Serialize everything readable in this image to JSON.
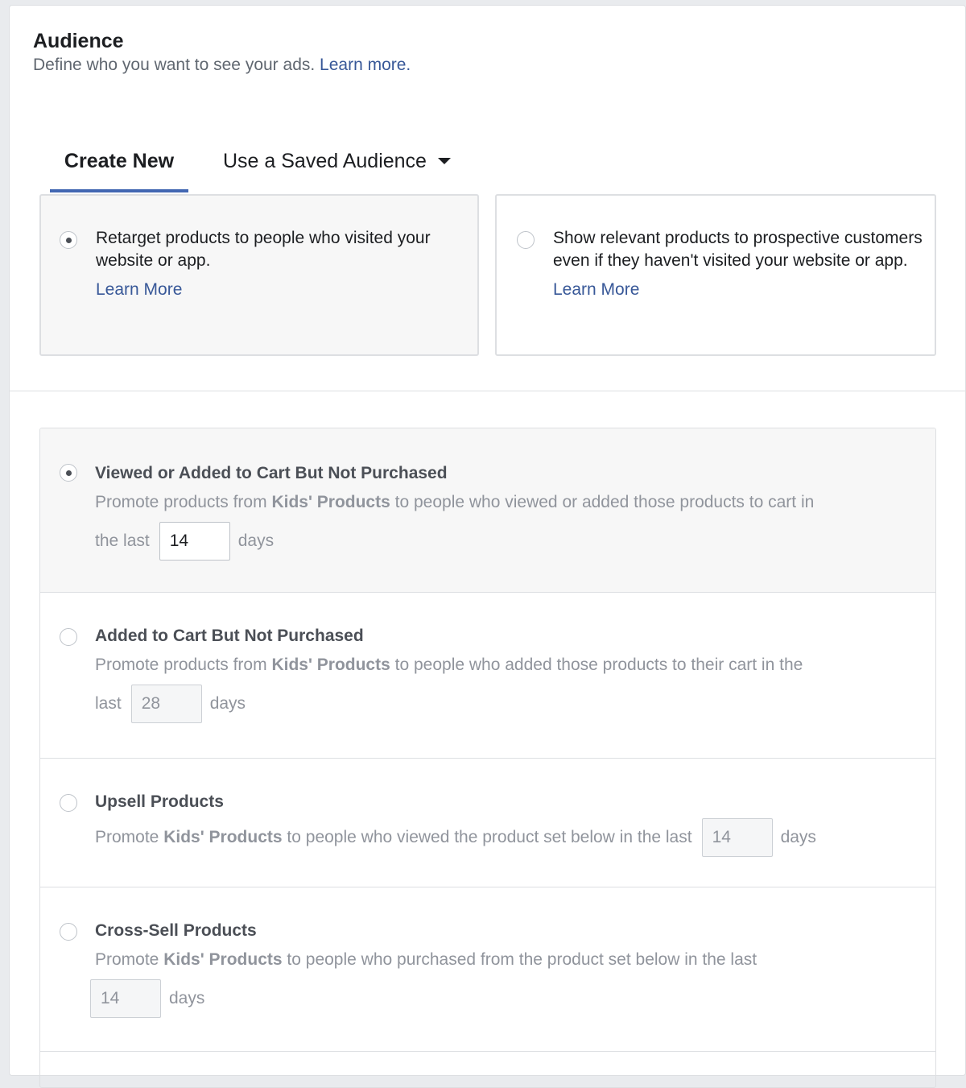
{
  "audience": {
    "title": "Audience",
    "subtitle": "Define who you want to see your ads.",
    "learn_more": "Learn more."
  },
  "tabs": {
    "create_new": "Create New",
    "saved_audience": "Use a Saved Audience"
  },
  "options": [
    {
      "text": "Retarget products to people who visited your website or app.",
      "learn_more": "Learn More",
      "selected": true
    },
    {
      "text": "Show relevant products to prospective customers even if they haven't visited your website or app.",
      "learn_more": "Learn More",
      "selected": false
    }
  ],
  "retarget_rows": [
    {
      "title": "Viewed or Added to Cart But Not Purchased",
      "pre": "Promote products from",
      "bold": "Kids' Products",
      "post": "to people who viewed or added those products to cart in",
      "lead": "the last",
      "days": "14",
      "unit": "days",
      "selected": true
    },
    {
      "title": "Added to Cart But Not Purchased",
      "pre": "Promote products from",
      "bold": "Kids' Products",
      "post": "to people who added those products to their cart in the",
      "lead": "last",
      "days": "28",
      "unit": "days",
      "selected": false
    },
    {
      "title": "Upsell Products",
      "pre": "Promote",
      "bold": "Kids' Products",
      "post": "to people who viewed the product set below in the last",
      "days": "14",
      "unit": "days",
      "selected": false
    },
    {
      "title": "Cross-Sell Products",
      "pre": "Promote",
      "bold": "Kids' Products",
      "post": "to people who purchased from the product set below in the last",
      "days": "14",
      "unit": "days",
      "selected": false
    }
  ]
}
